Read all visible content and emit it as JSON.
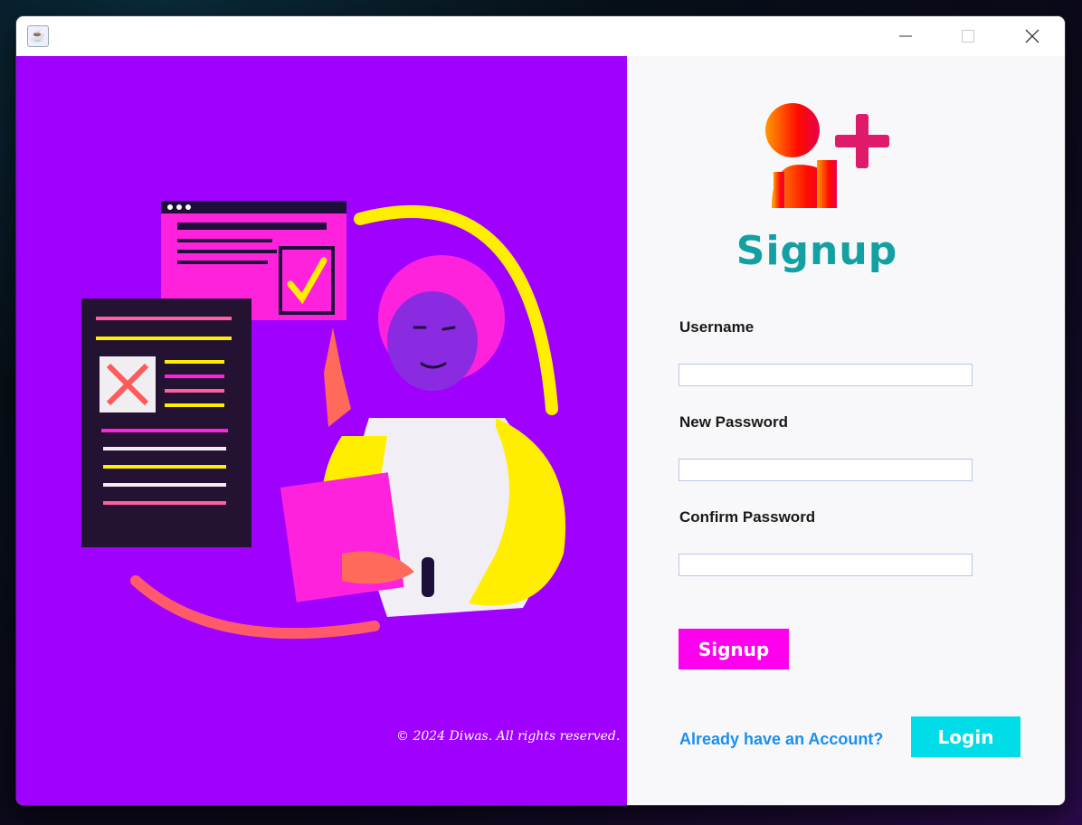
{
  "window": {
    "icon": "java-cup-icon",
    "controls": {
      "minimize": "minimize-icon",
      "maximize": "maximize-icon",
      "close": "close-icon"
    }
  },
  "left": {
    "background": "#a000ff",
    "illustration": "person-with-documents-illustration",
    "copyright": "© 2024 Diwas. All rights reserved."
  },
  "right": {
    "icon": "add-user-icon",
    "title": "Signup",
    "fields": [
      {
        "label": "Username",
        "value": ""
      },
      {
        "label": "New Password",
        "value": ""
      },
      {
        "label": "Confirm Password",
        "value": ""
      }
    ],
    "signup_button": "Signup",
    "have_account_text": "Already have an Account?",
    "login_button": "Login"
  },
  "colors": {
    "accent_magenta": "#ff00ee",
    "accent_cyan": "#00dde8",
    "title_teal": "#13a0a3",
    "link_blue": "#1a8ff0"
  }
}
